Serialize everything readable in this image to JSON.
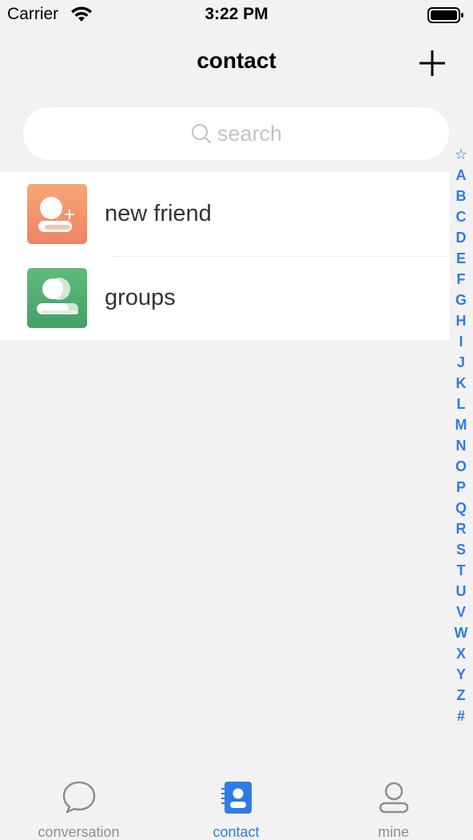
{
  "status_bar": {
    "carrier": "Carrier",
    "time": "3:22 PM"
  },
  "nav": {
    "title": "contact",
    "add_icon": "plus-icon"
  },
  "search": {
    "placeholder": "search",
    "icon": "search-icon"
  },
  "list": {
    "items": [
      {
        "label": "new friend",
        "icon": "add-friend-icon",
        "color_top": "#f5a873",
        "color_bottom": "#ef8266"
      },
      {
        "label": "groups",
        "icon": "group-icon",
        "color_top": "#5fba7d",
        "color_bottom": "#44a064"
      }
    ]
  },
  "index": [
    "☆",
    "A",
    "B",
    "C",
    "D",
    "E",
    "F",
    "G",
    "H",
    "I",
    "J",
    "K",
    "L",
    "M",
    "N",
    "O",
    "P",
    "Q",
    "R",
    "S",
    "T",
    "U",
    "V",
    "W",
    "X",
    "Y",
    "Z",
    "#"
  ],
  "tabs": [
    {
      "label": "conversation",
      "icon": "chat-bubble-icon",
      "active": false
    },
    {
      "label": "contact",
      "icon": "contact-book-icon",
      "active": true
    },
    {
      "label": "mine",
      "icon": "person-icon",
      "active": false
    }
  ],
  "colors": {
    "accent": "#2f7be6",
    "inactive": "#8e8e8e",
    "background": "#f2f2f2"
  }
}
